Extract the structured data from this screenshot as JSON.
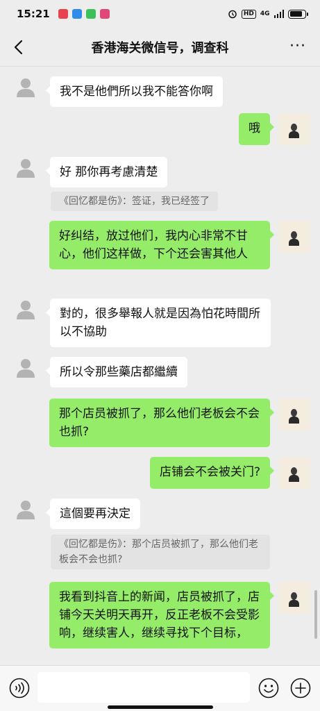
{
  "status_bar": {
    "time": "15:21",
    "hd_label": "HD",
    "network": "4G",
    "notification_colors": [
      "#e8434c",
      "#2f8ce8",
      "#3cc15a",
      "#e0487a"
    ],
    "battery_fraction": 0.85
  },
  "header": {
    "title": "香港海关微信号，调查科",
    "back_icon": "chevron-left-icon",
    "more_icon": "more-dots-icon",
    "more_label": "···"
  },
  "colors": {
    "sent_bubble": "#95ec69",
    "received_bubble": "#ffffff",
    "background": "#ededed"
  },
  "messages": [
    {
      "dir": "in",
      "text": "我不是他們所以我不能答你啊"
    },
    {
      "dir": "out",
      "text": "哦"
    },
    {
      "dir": "in",
      "text": "好 那你再考慮清楚",
      "quote": "《回忆都是伤》：签证，我已经签了"
    },
    {
      "dir": "out",
      "text": "好纠结，放过他们，我内心非常不甘心，他们这样做，下个还会害其他人"
    },
    {
      "dir": "in",
      "text": "對的，很多舉報人就是因為怕花時間所以不協助"
    },
    {
      "dir": "in",
      "text": "所以令那些藥店都繼續"
    },
    {
      "dir": "out",
      "text": "那个店员被抓了，那么他们老板会不会也抓?"
    },
    {
      "dir": "out",
      "text": "店铺会不会被关门?"
    },
    {
      "dir": "in",
      "text": "這個要再決定",
      "quote": "《回忆都是伤》：那个店员被抓了，那么他们老板会不会也抓?"
    },
    {
      "dir": "out",
      "text": "我看到抖音上的新闻，店员被抓了，店铺今天关明天再开，反正老板不会受影响，继续害人，继续寻找下个目标，"
    }
  ],
  "input_bar": {
    "voice_icon": "voice-icon",
    "emoji_icon": "emoji-icon",
    "plus_icon": "plus-icon",
    "text_value": ""
  }
}
